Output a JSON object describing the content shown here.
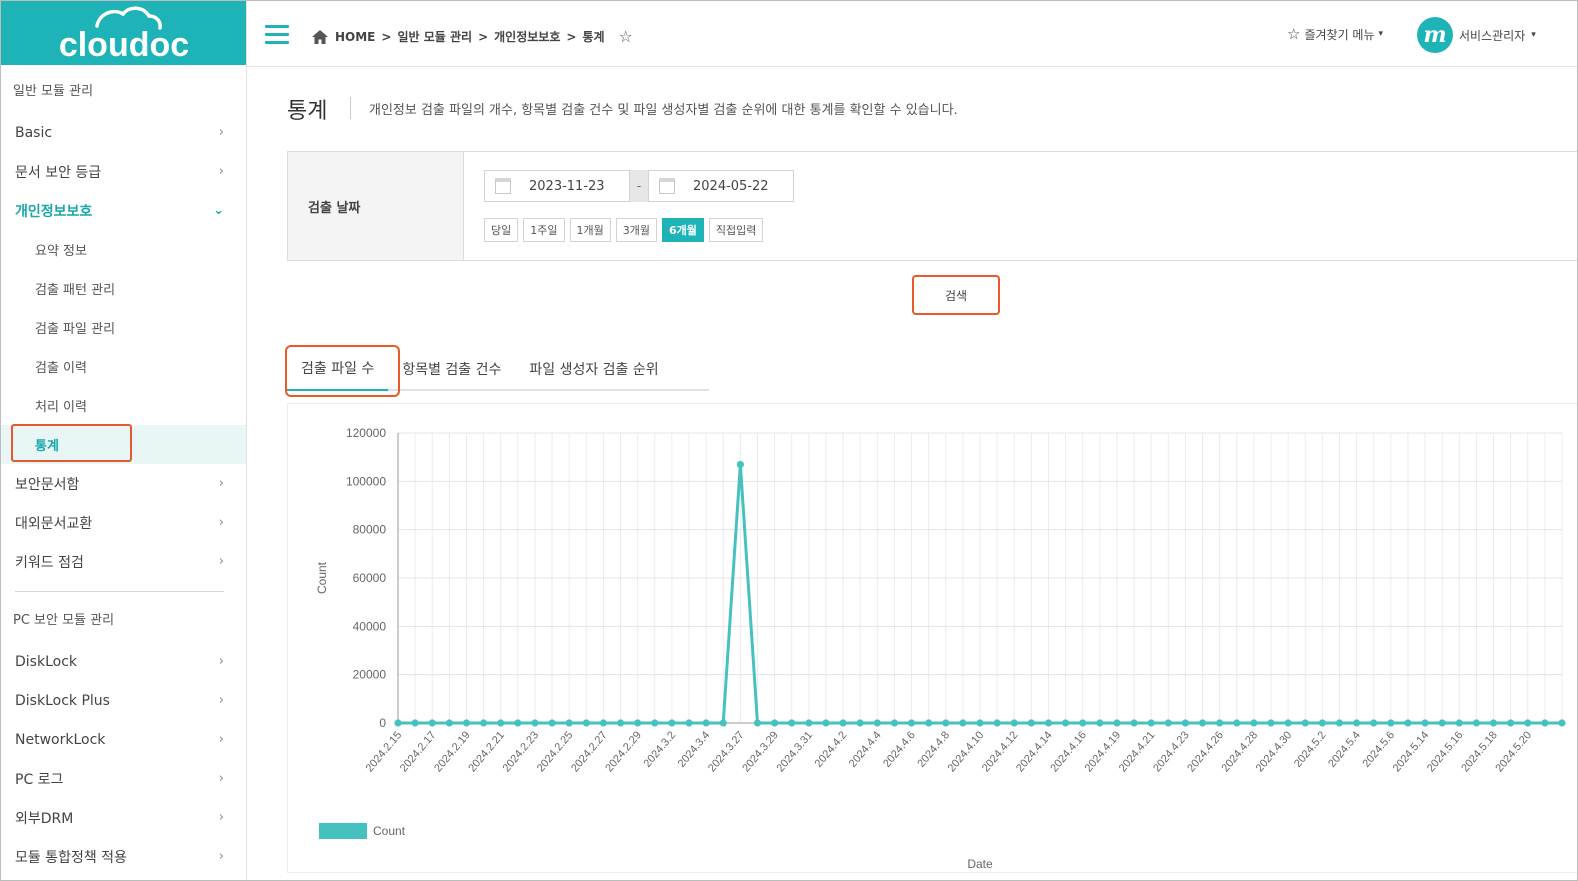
{
  "sidebar": {
    "logo_text": "cloudoc",
    "sections": [
      {
        "title": "일반 모듈 관리"
      },
      {
        "title": "PC 보안 모듈 관리"
      }
    ],
    "items_general": [
      {
        "label": "Basic"
      },
      {
        "label": "문서 보안 등급"
      },
      {
        "label": "개인정보보호"
      }
    ],
    "sub_items": [
      {
        "label": "요약 정보"
      },
      {
        "label": "검출 패턴 관리"
      },
      {
        "label": "검출 파일 관리"
      },
      {
        "label": "검출 이력"
      },
      {
        "label": "처리 이력"
      },
      {
        "label": "통계"
      }
    ],
    "items_general_after": [
      {
        "label": "보안문서함"
      },
      {
        "label": "대외문서교환"
      },
      {
        "label": "키워드 점검"
      }
    ],
    "items_pc": [
      {
        "label": "DiskLock"
      },
      {
        "label": "DiskLock Plus"
      },
      {
        "label": "NetworkLock"
      },
      {
        "label": "PC 로그"
      },
      {
        "label": "외부DRM"
      },
      {
        "label": "모듈 통합정책 적용"
      }
    ],
    "chevron_right": "›",
    "chevron_down": "⌄"
  },
  "header": {
    "breadcrumb": [
      "HOME",
      "일반 모듈 관리",
      "개인정보보호",
      "통계"
    ],
    "separator": ">",
    "favorites_menu": "즐겨찾기 메뉴",
    "user_name": "서비스관리자",
    "avatar_letter": "m",
    "dropdown": "▾",
    "star": "☆"
  },
  "page": {
    "title": "통계",
    "description": "개인정보 검출 파일의 개수, 항목별 검출 건수 및 파일 생성자별 검출 순위에 대한 통계를 확인할 수 있습니다."
  },
  "filter": {
    "label": "검출 날짜",
    "start_date": "2023-11-23",
    "end_date": "2024-05-22",
    "dash": "-",
    "ranges": [
      "당일",
      "1주일",
      "1개월",
      "3개월",
      "6개월",
      "직접입력"
    ],
    "selected_range": "6개월",
    "search_label": "검색"
  },
  "tabs": [
    {
      "label": "검출 파일 수"
    },
    {
      "label": "항목별 검출 건수"
    },
    {
      "label": "파일 생성자 검출 순위"
    }
  ],
  "active_tab": "검출 파일 수",
  "colors": {
    "brand": "#1eb4b7",
    "series": "#45c2c0",
    "highlight": "#e85a2a"
  },
  "chart_data": {
    "type": "line",
    "xlabel": "Date",
    "ylabel": "Count",
    "ylim": [
      0,
      120000
    ],
    "yticks": [
      0,
      20000,
      40000,
      60000,
      80000,
      100000,
      120000
    ],
    "grid": true,
    "legend_position": "bottom-left",
    "x_tick_labels": [
      "2024.2.15",
      "2024.2.17",
      "2024.2.19",
      "2024.2.21",
      "2024.2.23",
      "2024.2.25",
      "2024.2.27",
      "2024.2.29",
      "2024.3.2",
      "2024.3.4",
      "2024.3.27",
      "2024.3.29",
      "2024.3.31",
      "2024.4.2",
      "2024.4.4",
      "2024.4.6",
      "2024.4.8",
      "2024.4.10",
      "2024.4.12",
      "2024.4.14",
      "2024.4.16",
      "2024.4.19",
      "2024.4.21",
      "2024.4.23",
      "2024.4.26",
      "2024.4.28",
      "2024.4.30",
      "2024.5.2",
      "2024.5.4",
      "2024.5.6",
      "2024.5.14",
      "2024.5.16",
      "2024.5.18",
      "2024.5.20"
    ],
    "series": [
      {
        "name": "Count",
        "values": [
          0,
          0,
          0,
          0,
          0,
          0,
          0,
          0,
          0,
          0,
          0,
          0,
          0,
          0,
          0,
          0,
          0,
          0,
          0,
          0,
          107000,
          0,
          0,
          0,
          0,
          0,
          0,
          0,
          0,
          0,
          0,
          0,
          0,
          0,
          0,
          0,
          0,
          0,
          0,
          0,
          0,
          0,
          0,
          0,
          0,
          0,
          0,
          0,
          0,
          0,
          0,
          0,
          0,
          0,
          0,
          0,
          0,
          0,
          0,
          0,
          0,
          0,
          0,
          0,
          0,
          0,
          0,
          0,
          0
        ]
      }
    ]
  }
}
